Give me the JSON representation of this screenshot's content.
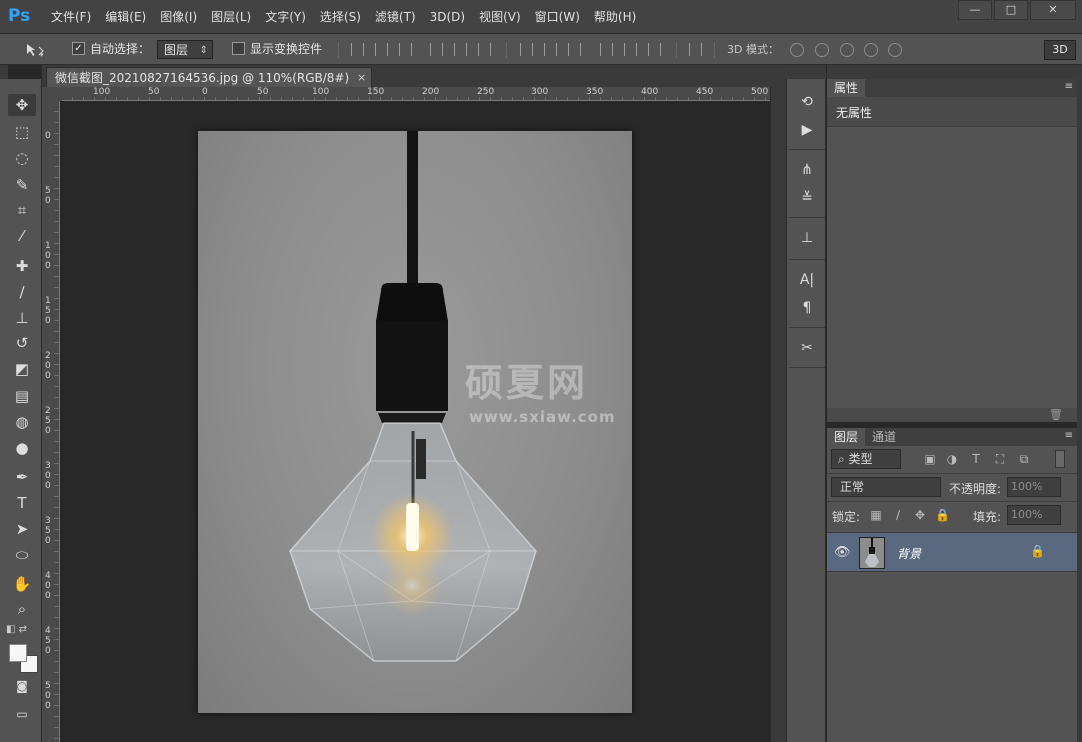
{
  "app": {
    "logo": "Ps"
  },
  "menu": [
    "文件(F)",
    "编辑(E)",
    "图像(I)",
    "图层(L)",
    "文字(Y)",
    "选择(S)",
    "滤镜(T)",
    "3D(D)",
    "视图(V)",
    "窗口(W)",
    "帮助(H)"
  ],
  "window_controls": {
    "minimize": "—",
    "maximize": "□",
    "close": "✕"
  },
  "options_bar": {
    "auto_select_label": "自动选择：",
    "auto_select_value": "图层",
    "show_transform_label": "显示变换控件",
    "mode_3d_label": "3D 模式：",
    "btn_3d": "3D",
    "auto_select_checked": "✓"
  },
  "document": {
    "tab_title": "微信截图_20210827164536.jpg @ 110%(RGB/8#)",
    "close": "×",
    "watermark": "硕夏网",
    "watermark_url": "www.sxiaw.com"
  },
  "ruler": {
    "h_labels": [
      "100",
      "50",
      "0",
      "50",
      "100",
      "150",
      "200",
      "250",
      "300",
      "350",
      "400",
      "450",
      "500"
    ],
    "v_labels": [
      "0",
      "50",
      "100",
      "150",
      "200",
      "250",
      "300",
      "350",
      "400",
      "450",
      "500"
    ]
  },
  "properties": {
    "tab": "属性",
    "none": "无属性"
  },
  "layers": {
    "tab_layers": "图层",
    "tab_channels": "通道",
    "filter": "⌕ 类型",
    "blend_mode": "正常",
    "opacity_label": "不透明度:",
    "opacity_value": "100%",
    "lock_label": "锁定:",
    "fill_label": "填充:",
    "fill_value": "100%",
    "layer_name": "背景"
  },
  "icons": {
    "move": "move-icon",
    "marquee": "rect-marquee-icon",
    "lasso": "lasso-icon",
    "quick_select": "quick-select-icon",
    "crop": "crop-icon",
    "eyedropper": "eyedropper-icon",
    "healing": "healing-brush-icon",
    "brush": "brush-icon",
    "stamp": "clone-stamp-icon",
    "history_brush": "history-brush-icon",
    "eraser": "eraser-icon",
    "gradient": "gradient-icon",
    "blur": "blur-icon",
    "dodge": "dodge-icon",
    "pen": "pen-icon",
    "type": "type-icon",
    "path_select": "path-select-icon",
    "shape": "ellipse-icon",
    "hand": "hand-icon",
    "zoom": "zoom-icon"
  },
  "colors": {
    "foreground": "#f7f7f7",
    "background": "#f7f7f7",
    "selected_layer": "#5a6880",
    "ps_blue": "#2fa3f6"
  }
}
